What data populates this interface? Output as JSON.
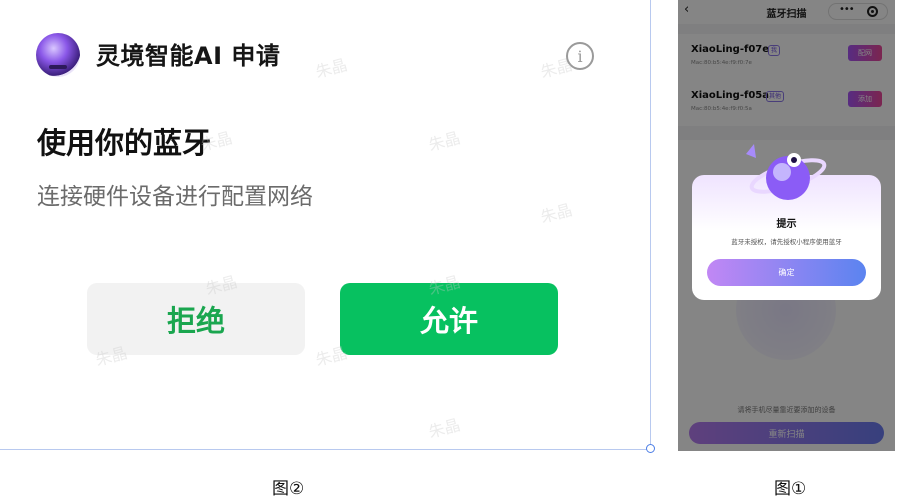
{
  "dialog": {
    "app_name": "灵境智能AI  申请",
    "info_glyph": "i",
    "request_title": "使用你的蓝牙",
    "request_desc": "连接硬件设备进行配置网络",
    "deny_label": "拒绝",
    "allow_label": "允许",
    "caption": "图②",
    "colors": {
      "allow_bg": "#07c160",
      "deny_text": "#1aa64f",
      "deny_bg": "#f2f2f2"
    }
  },
  "watermark_text": "朱晶",
  "phone": {
    "caption": "图①",
    "nav": {
      "back_glyph": "‹",
      "title": "蓝牙扫描",
      "menu_glyph": "•••"
    },
    "devices": [
      {
        "name": "XiaoLing-f07e",
        "tag": "我",
        "mac": "Mac:80:b5:4e:f9:f0:7e",
        "action": "配网"
      },
      {
        "name": "XiaoLing-f05a",
        "tag": "其他",
        "mac": "Mac:80:b5:4e:f9:f0:5a",
        "action": "添加"
      }
    ],
    "scan_hint": "请将手机尽量靠近要添加的设备",
    "rescan_label": "重新扫描",
    "modal": {
      "title": "提示",
      "message": "蓝牙未授权，请先授权小程序使用蓝牙",
      "confirm_label": "确定"
    }
  }
}
